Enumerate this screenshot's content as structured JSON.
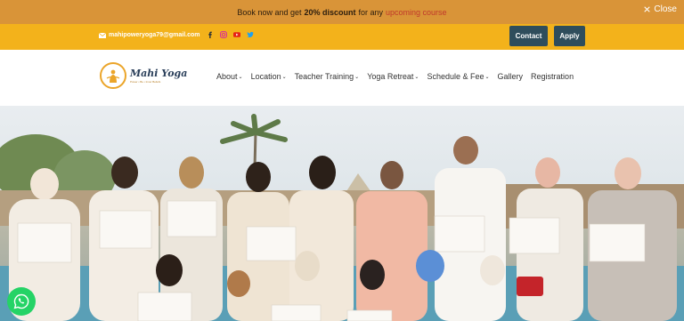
{
  "announcement": {
    "prefix": "Book now and get",
    "highlight": "20% discount",
    "middle": "for any",
    "link": "upcoming course",
    "close_label": "Close"
  },
  "topbar": {
    "email": "mahipoweryoga79@gmail.com",
    "contact_label": "Contact",
    "apply_label": "Apply",
    "socials": [
      "facebook-icon",
      "instagram-icon",
      "youtube-icon",
      "twitter-icon"
    ]
  },
  "header": {
    "logo_name": "Mahi Yoga",
    "logo_tagline": "Power • Be • Inner Beliefs",
    "nav": [
      {
        "label": "About",
        "caret": true
      },
      {
        "label": "Location",
        "caret": true
      },
      {
        "label": "Teacher Training",
        "caret": true
      },
      {
        "label": "Yoga Retreat",
        "caret": true
      },
      {
        "label": "Schedule & Fee",
        "caret": true
      },
      {
        "label": "Gallery",
        "caret": false
      },
      {
        "label": "Registration",
        "caret": false
      }
    ]
  },
  "hero": {
    "image": "group-photo-certificates"
  },
  "colors": {
    "announce_bg": "#d99438",
    "topbar_bg": "#f3b21b",
    "button_bg": "#2f4d5c",
    "whatsapp": "#25d366"
  }
}
